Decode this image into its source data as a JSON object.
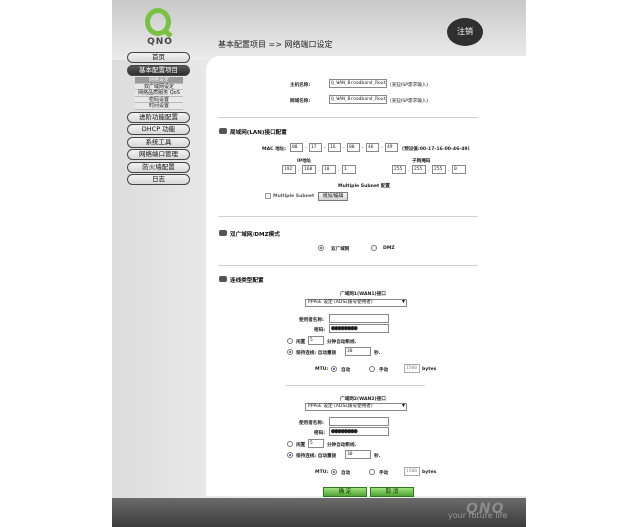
{
  "brand": {
    "logo_text": "QNO",
    "tagline": "your future life",
    "footer_logo": "QNO"
  },
  "header": {
    "logout_label": "注销",
    "breadcrumb": "基本配置项目 => 网络端口设定"
  },
  "sidebar": {
    "items": [
      {
        "label": "首页"
      },
      {
        "label": "基本配置项目",
        "active": true
      },
      {
        "label": "进阶功能配置"
      },
      {
        "label": "DHCP 功能"
      },
      {
        "label": "系统工具"
      },
      {
        "label": "网络端口管理"
      },
      {
        "label": "防火墙配置"
      },
      {
        "label": "日志"
      }
    ],
    "submenu": [
      {
        "label": "网络设定",
        "selected": true
      },
      {
        "label": "双广域网设定"
      },
      {
        "label": "网络品质服务 QoS"
      },
      {
        "label": "密码设置"
      },
      {
        "label": "时间设置"
      }
    ]
  },
  "host": {
    "host_name_label": "主机名称:",
    "host_name_value": "Q_WAN_Broadband_Route",
    "host_note": "(某些ISP需求输入)",
    "domain_label": "网域名称:",
    "domain_value": "Q_WAN_Broadband_Route",
    "domain_note": "(某些ISP需求输入)"
  },
  "lan": {
    "section_title": "局域网(LAN)接口配置",
    "mac_label": "MAC 地址:",
    "mac_octets": [
      "00",
      "17",
      "16",
      "00",
      "46",
      "49"
    ],
    "mac_default": "(预设值:00-17-16-00-46-49)",
    "ip_label": "IP地址",
    "ip_octets": [
      "192",
      "168",
      "10",
      "1"
    ],
    "mask_label": "子网掩码",
    "mask_octets": [
      "255",
      "255",
      "255",
      "0"
    ],
    "multi_subnet_title": "Multiple Subnet 配置",
    "multi_subnet_checkbox": "Multiple Subnet",
    "add_edit_button": "增加/编辑"
  },
  "dmz": {
    "section_title": "双广域网/DMZ模式",
    "option_dual_wan": "双广域网",
    "option_dmz": "DMZ"
  },
  "connection": {
    "section_title": "连线类型配置",
    "wan1": {
      "title": "广域网1(WAN1)接口",
      "type_selected": "PPPoE 设定 (ADSL拨号使用者)",
      "user_label": "使用者名称:",
      "user_value": "",
      "password_label": "密码:",
      "password_value": "●●●●●●●●",
      "idle_label": "闲置",
      "idle_value": "5",
      "idle_suffix": "分钟自动断线.",
      "keepalive_label": "保持连线: 自动重拨",
      "keepalive_value": "30",
      "keepalive_suffix": "秒.",
      "mtu_label": "MTU:",
      "mtu_auto": "自动",
      "mtu_manual": "手动",
      "mtu_value": "1500",
      "mtu_unit": "bytes"
    },
    "wan2": {
      "title": "广域网2(WAN2)接口",
      "type_selected": "PPPoE 设定 (ADSL拨号使用者)",
      "user_label": "使用者名称:",
      "user_value": "",
      "password_label": "密码:",
      "password_value": "●●●●●●●●",
      "idle_label": "闲置",
      "idle_value": "5",
      "idle_suffix": "分钟自动断线.",
      "keepalive_label": "保持连线: 自动重拨",
      "keepalive_value": "30",
      "keepalive_suffix": "秒.",
      "mtu_label": "MTU:",
      "mtu_auto": "自动",
      "mtu_manual": "手动",
      "mtu_value": "1500",
      "mtu_unit": "bytes"
    }
  },
  "actions": {
    "ok_label": "确 定",
    "cancel_label": "取 消"
  }
}
